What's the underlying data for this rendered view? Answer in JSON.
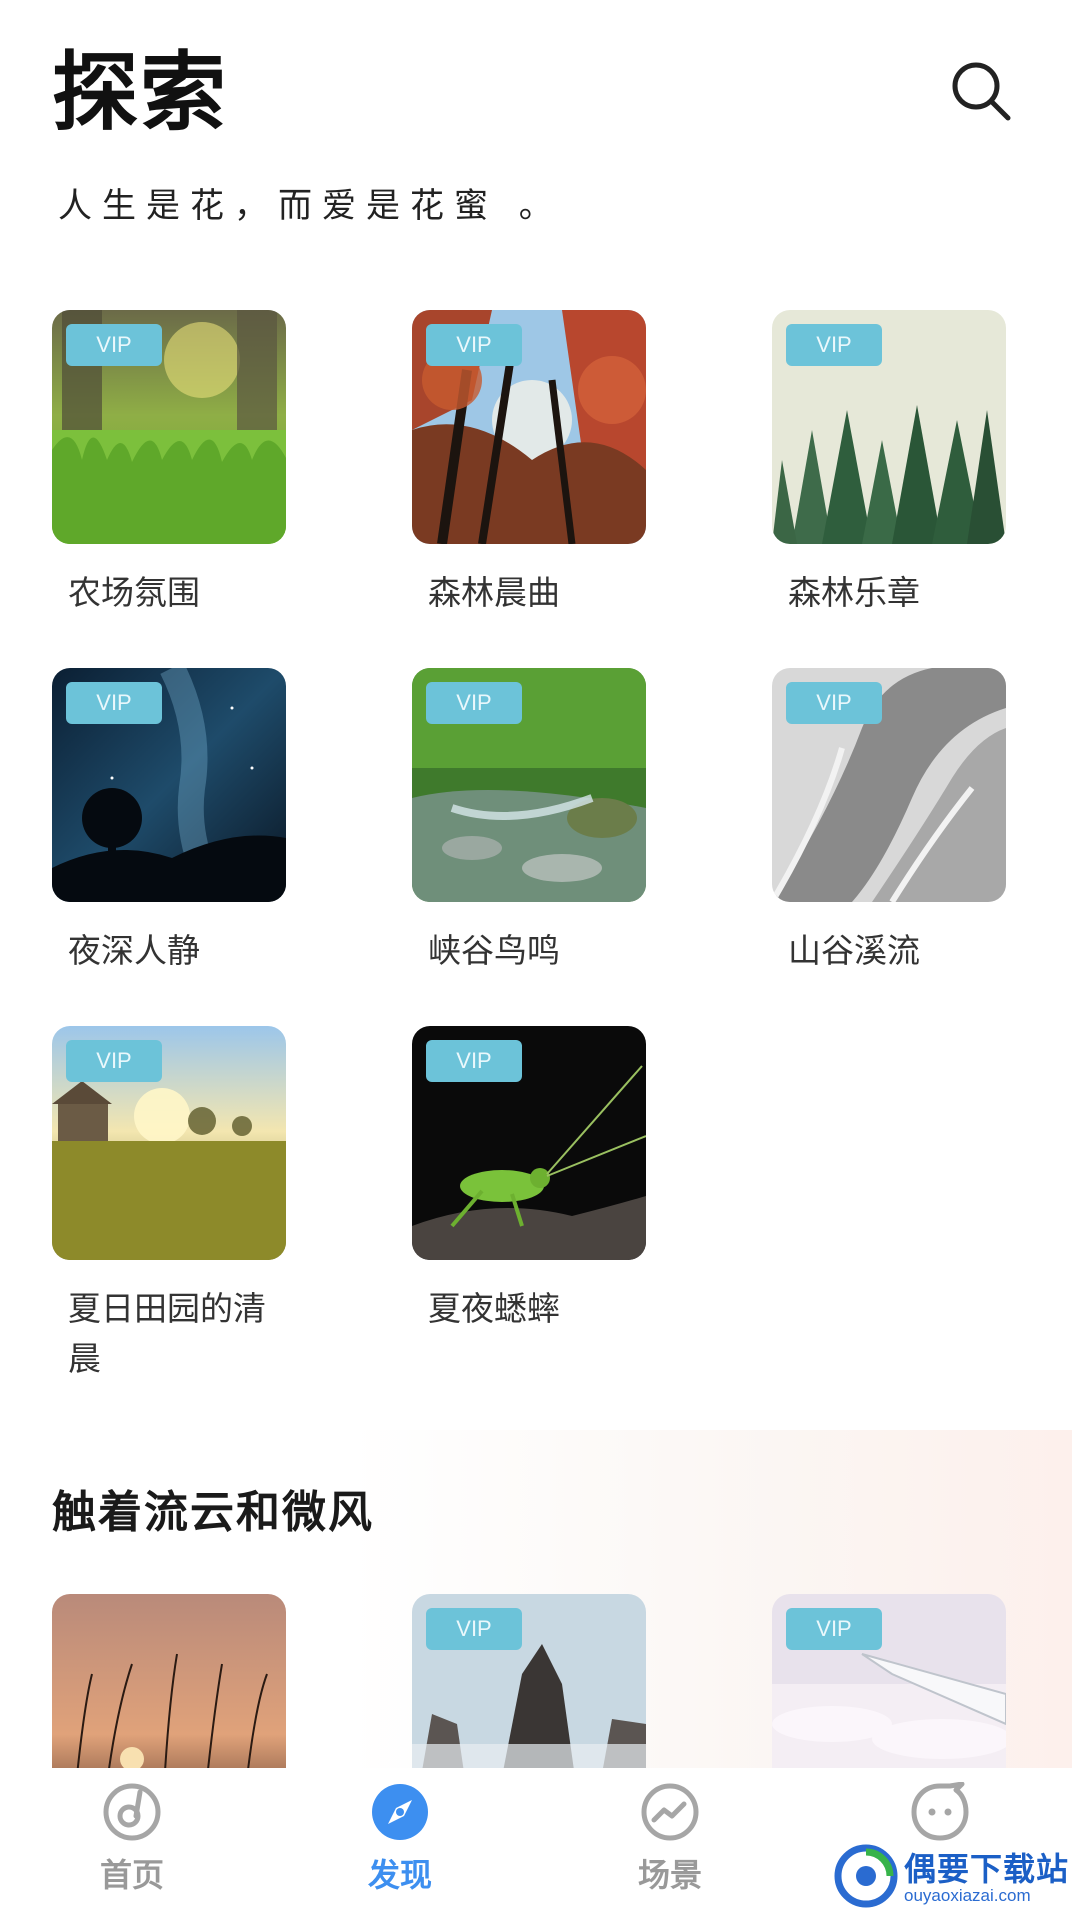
{
  "header": {
    "title": "探索",
    "tagline": "人生是花，而爱是花蜜 。",
    "search_icon": "search-icon"
  },
  "vip_label": "VIP",
  "cards": [
    {
      "title": "农场氛围",
      "vip": true
    },
    {
      "title": "森林晨曲",
      "vip": true
    },
    {
      "title": "森林乐章",
      "vip": true
    },
    {
      "title": "夜深人静",
      "vip": true
    },
    {
      "title": "峡谷鸟鸣",
      "vip": true
    },
    {
      "title": "山谷溪流",
      "vip": true
    },
    {
      "title": "夏日田园的清晨",
      "vip": true
    },
    {
      "title": "夏夜蟋蟀",
      "vip": true
    }
  ],
  "section2": {
    "title": "触着流云和微风",
    "cards": [
      {
        "vip": false
      },
      {
        "vip": true
      },
      {
        "vip": true
      }
    ]
  },
  "tabbar": {
    "tabs": [
      {
        "label": "首页",
        "icon": "music-disc-icon",
        "active": false
      },
      {
        "label": "发现",
        "icon": "compass-icon",
        "active": true
      },
      {
        "label": "场景",
        "icon": "trend-icon",
        "active": false
      },
      {
        "label": "",
        "icon": "chat-face-icon",
        "active": false
      }
    ],
    "active_color": "#3d8ff0",
    "inactive_color": "#999999"
  },
  "watermark": {
    "name": "偶要下载站",
    "url": "ouyaoxiazai.com"
  },
  "colors": {
    "vip_badge": "#6cc3d9",
    "accent": "#3d8ff0"
  }
}
